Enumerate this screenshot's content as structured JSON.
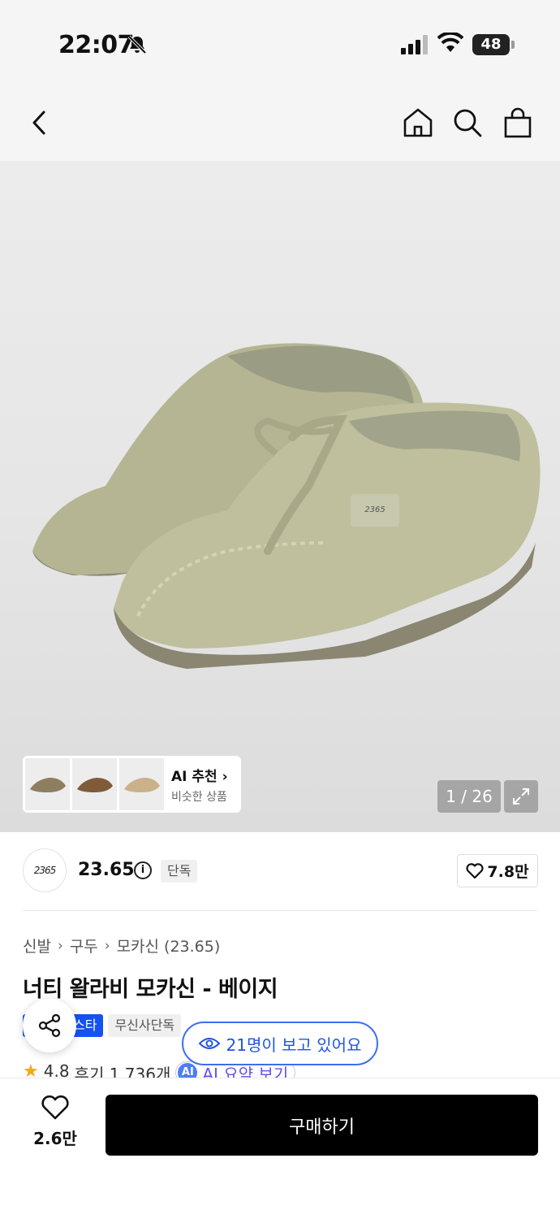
{
  "status_bar": {
    "time": "22:07",
    "battery": "48"
  },
  "nav": {
    "back": "back-icon",
    "home": "home-icon",
    "search": "search-icon",
    "cart": "shopping-bag-icon"
  },
  "hero": {
    "ai_recommend_title": "AI 추천",
    "ai_recommend_sub": "비슷한 상품",
    "counter": "1 / 26"
  },
  "brand": {
    "logo_text": "2365",
    "name": "23.65",
    "exclusive_badge": "단독",
    "likes": "7.8만"
  },
  "breadcrumb": [
    "신발",
    "구두",
    "모카신 (23.65)"
  ],
  "product": {
    "title": "너티 왈라비 모카신 - 베이지",
    "tag_blue": "스타",
    "tag_gray": "무신사단독",
    "viewing": "21명이 보고 있어요",
    "rating": "4.8",
    "reviews": "후기 1,736개",
    "ai_summary_badge": "AI",
    "ai_summary": "AI 요약 보기"
  },
  "bottom_bar": {
    "fav_count": "2.6만",
    "buy_label": "구매하기"
  },
  "colors": {
    "accent_blue": "#1652f0",
    "star": "#f5a623",
    "buy_bg": "#000000"
  }
}
